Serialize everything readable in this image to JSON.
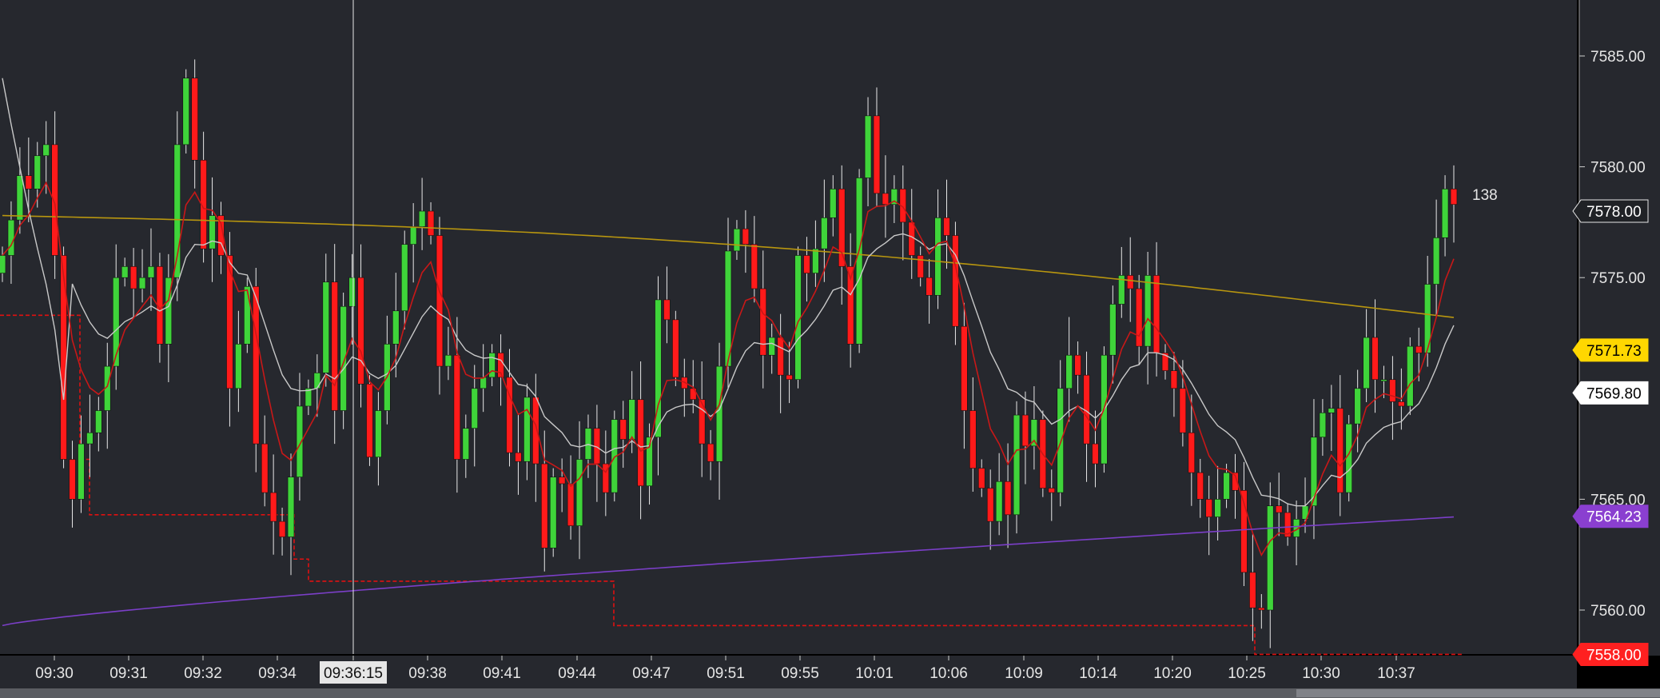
{
  "chart_data": {
    "type": "candlestick",
    "ylim": [
      7556.5,
      7587.5
    ],
    "y_ticks": [
      "7585.00",
      "7580.00",
      "7575.00",
      "7570.00",
      "7565.00",
      "7560.00"
    ],
    "x_ticks": [
      "09:30",
      "09:31",
      "09:32",
      "09:34",
      "09:36:15",
      "09:38",
      "09:41",
      "09:44",
      "09:47",
      "09:51",
      "09:55",
      "10:01",
      "10:06",
      "10:09",
      "10:14",
      "10:20",
      "10:25",
      "10:30",
      "10:37"
    ],
    "crosshair_time": "09:36:15",
    "bar_counter": "138",
    "price_badges": [
      {
        "value": 7578.0,
        "text": "7578.00",
        "bg": "#202226",
        "fg": "#ffffff"
      },
      {
        "value": 7571.73,
        "text": "7571.73",
        "bg": "#ffd700",
        "fg": "#000000"
      },
      {
        "value": 7569.8,
        "text": "7569.80",
        "bg": "#ffffff",
        "fg": "#000000"
      },
      {
        "value": 7564.23,
        "text": "7564.23",
        "bg": "#8a3fd0",
        "fg": "#ffffff"
      },
      {
        "value": 7558.0,
        "text": "7558.00",
        "bg": "#ff2020",
        "fg": "#ffffff"
      }
    ],
    "colors": {
      "background": "#26282e",
      "up": "#3fd43a",
      "down": "#ff1a1a",
      "vwap": "#7b3fc8",
      "ma_slow": "#b8960f",
      "ma_mid": "#c9c9c9",
      "ma_fast": "#c81818",
      "support": "#e01010"
    },
    "candle_closes": [
      7576,
      7577.6,
      7579.6,
      7579,
      7580.5,
      7581,
      7576,
      7566.8,
      7565,
      7567.5,
      7568,
      7569,
      7571,
      7575,
      7575.5,
      7574.5,
      7575,
      7575.5,
      7572,
      7575,
      7581,
      7584,
      7580.3,
      7576.3,
      7577.8,
      7576,
      7570,
      7572,
      7574.6,
      7567.5,
      7565.3,
      7564,
      7563.3,
      7566,
      7569.2,
      7570,
      7570.7,
      7574.8,
      7569,
      7573.7,
      7575,
      7570.2,
      7566.9,
      7569,
      7572,
      7573.5,
      7576.5,
      7577.3,
      7578,
      7576.9,
      7571,
      7571.5,
      7566.8,
      7568.2,
      7570,
      7570.5,
      7571.6,
      7570.5,
      7567.1,
      7566.7,
      7569.6,
      7566.6,
      7562.8,
      7566,
      7565.7,
      7563.8,
      7566.8,
      7568.2,
      7566.6,
      7565.3,
      7568.6,
      7567.7,
      7569.5,
      7565.6,
      7567.8,
      7574,
      7573.1,
      7570.5,
      7570,
      7569.5,
      7567.5,
      7566.7,
      7571,
      7576.2,
      7577.2,
      7576.5,
      7574.5,
      7571.5,
      7572.3,
      7570.6,
      7570.4,
      7576,
      7575.2,
      7576.3,
      7577.7,
      7579,
      7575.5,
      7572,
      7579.5,
      7582.3,
      7578.8,
      7578.3,
      7579,
      7577.5,
      7576,
      7575,
      7574.2,
      7577.7,
      7576.9,
      7572.8,
      7569,
      7566.4,
      7565.5,
      7564,
      7565.8,
      7564.3,
      7568.8,
      7567.4,
      7568.6,
      7565.5,
      7565.3,
      7570,
      7571.5,
      7570.6,
      7567.5,
      7566.6,
      7571.5,
      7573.8,
      7575.1,
      7574.5,
      7571.9,
      7575.1,
      7571.6,
      7570.8,
      7570,
      7568,
      7566.2,
      7565,
      7564.2,
      7565,
      7566.2,
      7565.4,
      7561.7,
      7560.1,
      7560,
      7564.7,
      7564.4,
      7563.3,
      7564.1,
      7564.7,
      7567.8,
      7568.9,
      7569.1,
      7565.3,
      7568.4,
      7570,
      7572.3,
      7570.4,
      7570.4,
      7569.4,
      7569.2,
      7571.9,
      7571.6,
      7574.7,
      7576.8,
      7579,
      7578.3
    ]
  }
}
